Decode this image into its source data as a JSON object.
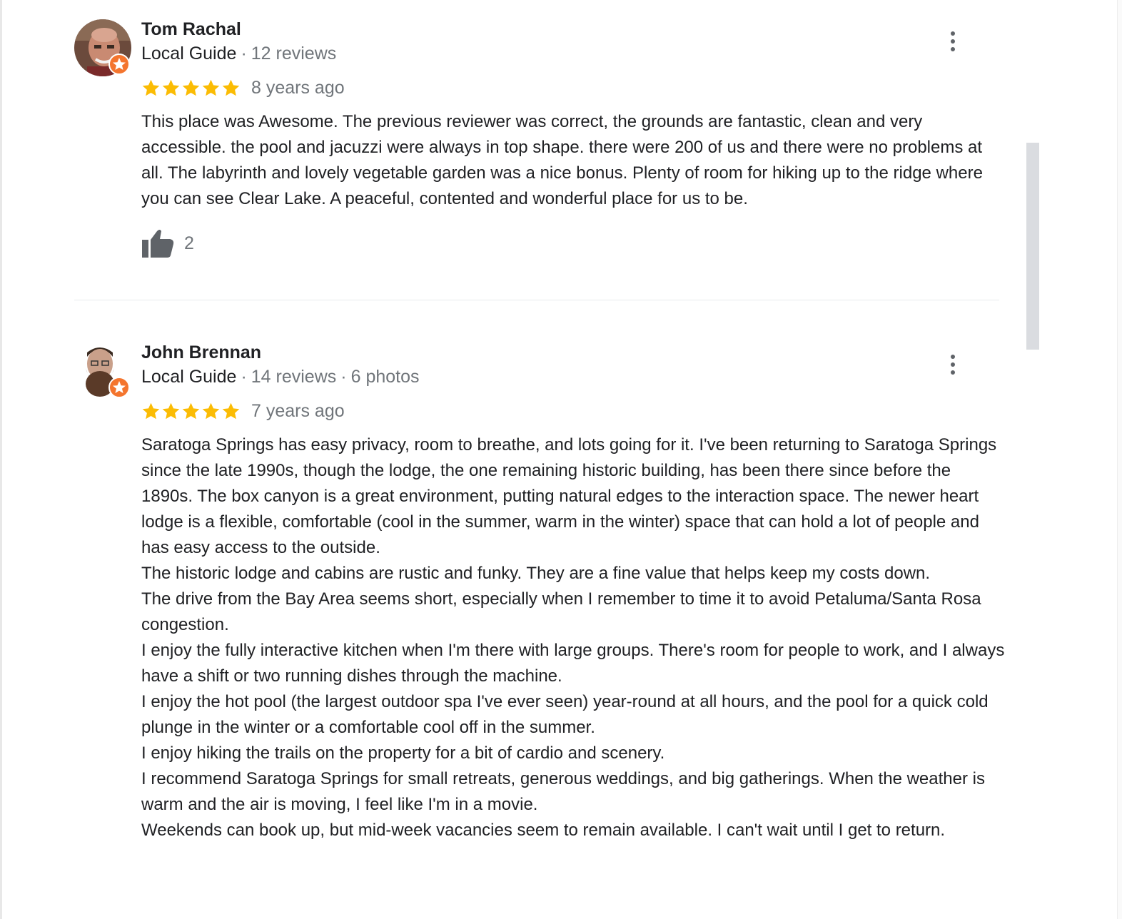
{
  "reviews": [
    {
      "name": "Tom Rachal",
      "guide": "Local Guide",
      "reviews_count": "12 reviews",
      "photos_count": "",
      "rating": 5,
      "date": "8 years ago",
      "paragraphs": [
        "This place was Awesome. The previous reviewer was correct, the grounds are fantastic, clean and very accessible. the pool and jacuzzi were always in top shape. there were 200 of us and there were no problems at all. The labyrinth and lovely vegetable garden was a nice bonus. Plenty of room for hiking up to the ridge where you can see Clear Lake. A peaceful, contented and wonderful place for us to be."
      ],
      "likes": "2"
    },
    {
      "name": "John Brennan",
      "guide": "Local Guide",
      "reviews_count": "14 reviews",
      "photos_count": "6 photos",
      "rating": 5,
      "date": "7 years ago",
      "paragraphs": [
        "Saratoga Springs has easy privacy, room to breathe, and lots going for it. I've been returning to Saratoga Springs since the late 1990s, though the lodge, the one remaining historic building, has been there since before the 1890s. The box canyon is a great environment, putting natural edges to the interaction space. The newer heart lodge is a flexible, comfortable (cool in the summer, warm in the winter) space that can hold a lot of people and has easy access to the outside.",
        "The historic lodge and cabins are rustic and funky. They are a fine value that helps keep my costs down.",
        "The drive from the Bay Area seems short, especially when I remember to time it to avoid Petaluma/Santa Rosa congestion.",
        "I enjoy the fully interactive kitchen when I'm there with large groups. There's room for people to work, and I always have a shift or two running dishes through the machine.",
        "I enjoy the hot pool (the largest outdoor spa I've ever seen) year-round at all hours, and the pool for a quick cold plunge in the winter or a comfortable cool off in the summer.",
        "I enjoy hiking the trails on the property for a bit of cardio and scenery.",
        "I recommend Saratoga Springs for small retreats, generous weddings, and big gatherings. When the weather is warm and the air is moving, I feel like I'm in a movie.",
        "Weekends can book up, but mid-week vacancies seem to remain available. I can't wait until I get to return."
      ]
    }
  ],
  "separator": "·",
  "colors": {
    "star": "#fbbc04",
    "badge": "#f4752e",
    "text": "#202124",
    "secondary": "#70757a"
  },
  "icons": {
    "more": "more-vert-icon",
    "like": "thumb-up-icon",
    "star": "star-icon",
    "badge": "local-guide-badge-icon"
  },
  "scrollbar_position": 0.25
}
